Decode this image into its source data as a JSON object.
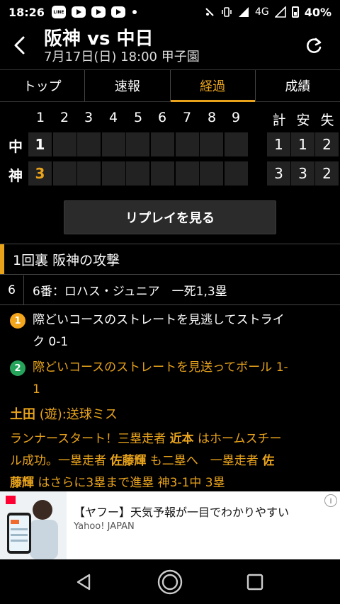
{
  "status": {
    "time": "18:26",
    "app_icons": [
      "LINE",
      "YouTube",
      "YouTube",
      "YouTube"
    ],
    "network": "4G",
    "battery": "40%"
  },
  "header": {
    "title": "阪神 vs 中日",
    "subtitle": "7月17日(日) 18:00 甲子園"
  },
  "tabs": [
    {
      "label": "トップ",
      "active": false
    },
    {
      "label": "速報",
      "active": false
    },
    {
      "label": "経過",
      "active": true
    },
    {
      "label": "成績",
      "active": false
    }
  ],
  "scoreboard": {
    "innings": [
      "1",
      "2",
      "3",
      "4",
      "5",
      "6",
      "7",
      "8",
      "9"
    ],
    "total_headers": [
      "計",
      "安",
      "失"
    ],
    "teams": [
      {
        "name": "中",
        "runs": [
          "1",
          "",
          "",
          "",
          "",
          "",
          "",
          "",
          ""
        ],
        "totals": [
          "1",
          "1",
          "2"
        ]
      },
      {
        "name": "神",
        "runs": [
          "3",
          "",
          "",
          "",
          "",
          "",
          "",
          "",
          ""
        ],
        "totals": [
          "3",
          "3",
          "2"
        ]
      }
    ]
  },
  "replay_button": "リプレイを見る",
  "section_title": "1回裏 阪神の攻撃",
  "batter": {
    "order": "6",
    "text": "6番：ロハス・ジュニア　一死1,3塁"
  },
  "pitches": [
    {
      "num": "1",
      "type": "strike",
      "line1": "際どいコースのストレートを見逃してストライ",
      "line2": "ク 0-1"
    },
    {
      "num": "2",
      "type": "ball",
      "line1": "際どいコースのストレートを見送ってボール 1-",
      "line2": "1"
    }
  ],
  "event": {
    "player": "土田",
    "desc": " (遊):送球ミス"
  },
  "narration": {
    "p1": "ランナースタート！三塁走者 ",
    "b1": "近本",
    "p2": " はホームスチー",
    "p3": "ル成功。一塁走者 ",
    "b2": "佐藤輝",
    "p4": " も二塁へ　一塁走者 ",
    "b3": "佐",
    "b4": "藤輝",
    "p5": " はさらに3塁まで進塁 神3-1中 3塁"
  },
  "ad": {
    "title": "【ヤフー】天気予報が一目でわかりやすい",
    "source": "Yahoo! JAPAN"
  },
  "colors": {
    "accent": "#e8a31b",
    "strike_badge": "#f3a51b",
    "ball_badge": "#26a35b",
    "cell_bg": "#222222"
  }
}
